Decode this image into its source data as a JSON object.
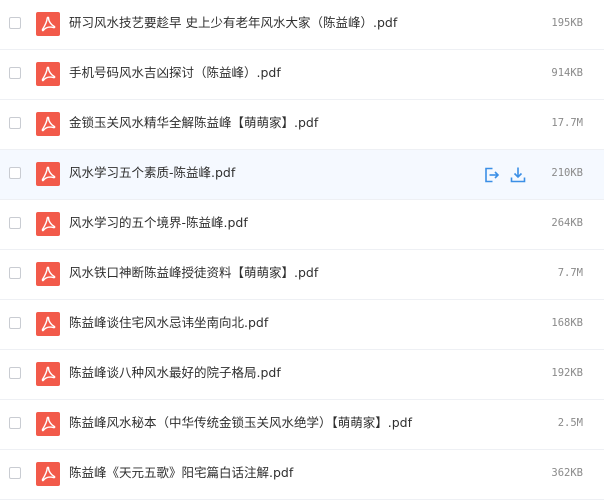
{
  "files": [
    {
      "name": "研习风水技艺要趁早 史上少有老年风水大家（陈益峰）.pdf",
      "size": "195KB"
    },
    {
      "name": "手机号码风水吉凶探讨（陈益峰）.pdf",
      "size": "914KB"
    },
    {
      "name": "金锁玉关风水精华全解陈益峰【萌萌家】.pdf",
      "size": "17.7M"
    },
    {
      "name": "风水学习五个素质-陈益峰.pdf",
      "size": "210KB"
    },
    {
      "name": "风水学习的五个境界-陈益峰.pdf",
      "size": "264KB"
    },
    {
      "name": "风水铁口神断陈益峰授徒资料【萌萌家】.pdf",
      "size": "7.7M"
    },
    {
      "name": "陈益峰谈住宅风水忌讳坐南向北.pdf",
      "size": "168KB"
    },
    {
      "name": "陈益峰谈八种风水最好的院子格局.pdf",
      "size": "192KB"
    },
    {
      "name": "陈益峰风水秘本（中华传统金锁玉关风水绝学）【萌萌家】.pdf",
      "size": "2.5M"
    },
    {
      "name": "陈益峰《天元五歌》阳宅篇白话注解.pdf",
      "size": "362KB"
    }
  ],
  "icons": {
    "file_type": "pdf-icon",
    "row_actions": [
      "share-icon",
      "download-icon"
    ]
  },
  "colors": {
    "pdf_icon": "#f25a4a",
    "action_icon": "#3b8fe6",
    "hover_row": "#f5f9ff"
  }
}
